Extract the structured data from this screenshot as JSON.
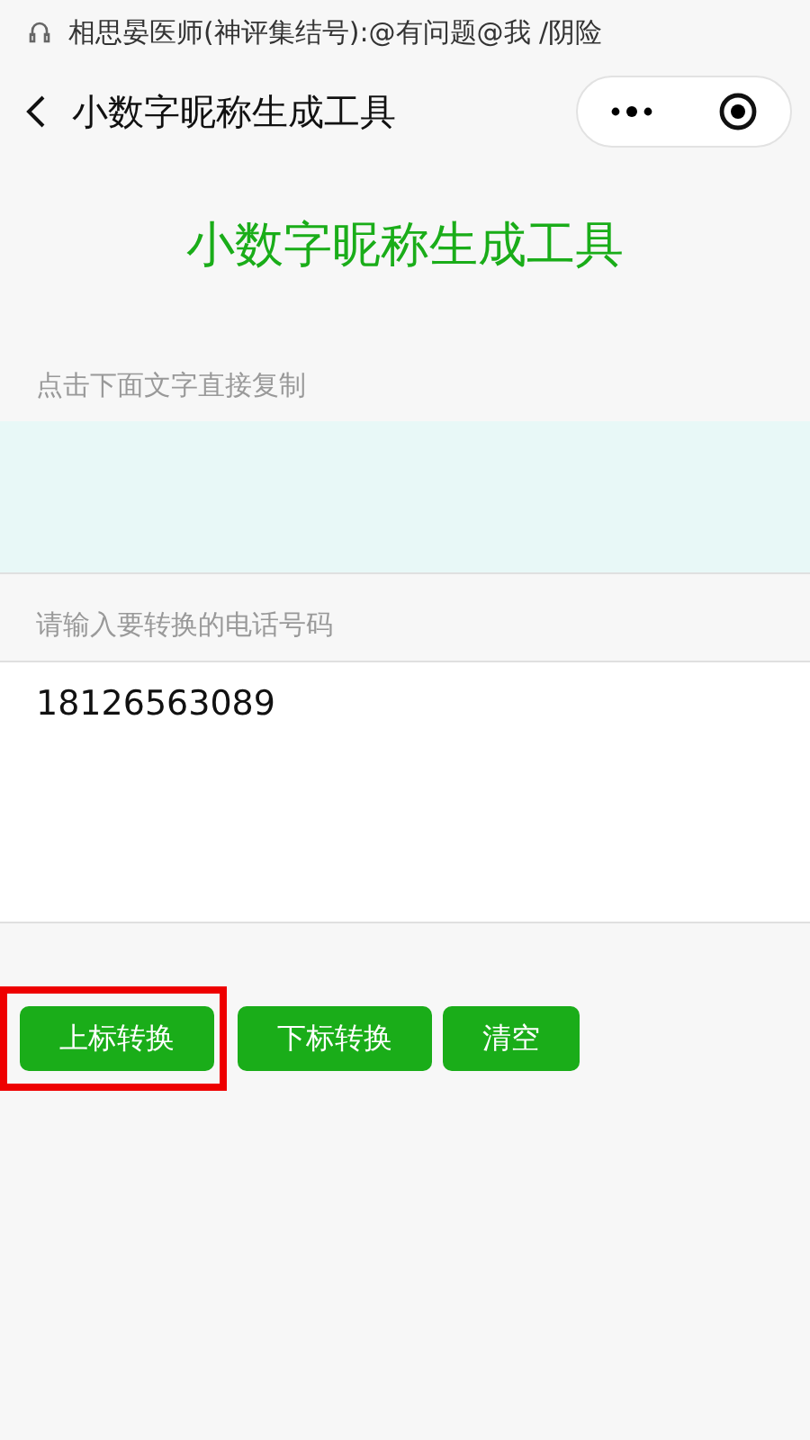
{
  "status_bar": {
    "text": "相思晏医师(神评集结号):@有问题@我 /阴险"
  },
  "nav": {
    "title": "小数字昵称生成工具"
  },
  "heading": "小数字昵称生成工具",
  "result": {
    "label": "点击下面文字直接复制"
  },
  "input": {
    "label": "请输入要转换的电话号码",
    "value": "18126563089"
  },
  "buttons": [
    {
      "label": "上标转换",
      "highlighted": true
    },
    {
      "label": "下标转换",
      "highlighted": false
    },
    {
      "label": "清空",
      "highlighted": false
    }
  ]
}
